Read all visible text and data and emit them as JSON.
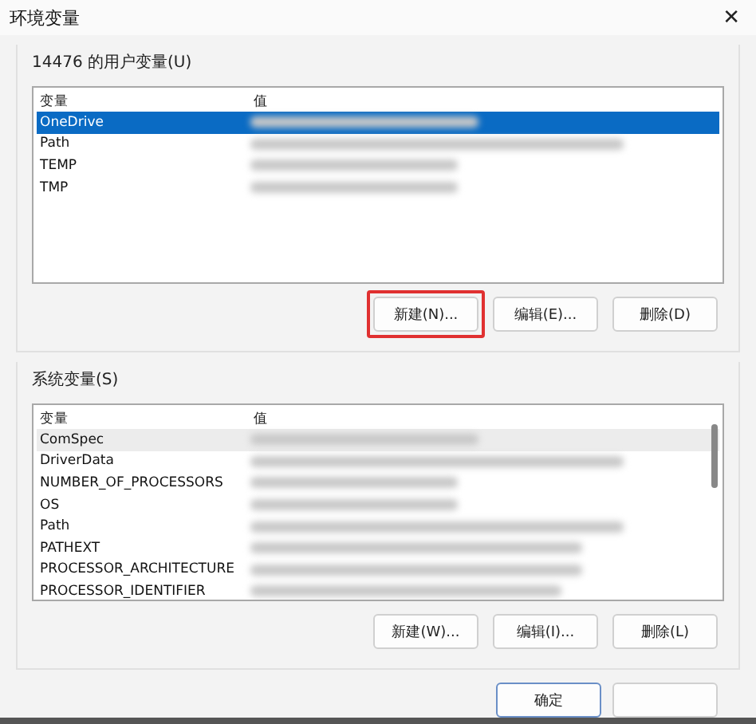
{
  "window": {
    "title": "环境变量",
    "close": "✕"
  },
  "user_vars": {
    "label": "14476 的用户变量(U)",
    "columns": [
      "变量",
      "值"
    ],
    "rows": [
      {
        "name": "OneDrive",
        "selected": true
      },
      {
        "name": "Path",
        "selected": false
      },
      {
        "name": "TEMP",
        "selected": false
      },
      {
        "name": "TMP",
        "selected": false
      }
    ],
    "buttons": [
      {
        "label": "新建(N)...",
        "highlighted": true
      },
      {
        "label": "编辑(E)...",
        "highlighted": false
      },
      {
        "label": "删除(D)",
        "highlighted": false
      }
    ]
  },
  "system_vars": {
    "label": "系统变量(S)",
    "columns": [
      "变量",
      "值"
    ],
    "rows": [
      {
        "name": "ComSpec",
        "selected": true
      },
      {
        "name": "DriverData",
        "selected": false
      },
      {
        "name": "NUMBER_OF_PROCESSORS",
        "selected": false
      },
      {
        "name": "OS",
        "selected": false
      },
      {
        "name": "Path",
        "selected": false
      },
      {
        "name": "PATHEXT",
        "selected": false
      },
      {
        "name": "PROCESSOR_ARCHITECTURE",
        "selected": false
      },
      {
        "name": "PROCESSOR_IDENTIFIER",
        "selected": false
      }
    ],
    "buttons": [
      {
        "label": "新建(W)...",
        "highlighted": false
      },
      {
        "label": "编辑(I)...",
        "highlighted": false
      },
      {
        "label": "删除(L)",
        "highlighted": false
      }
    ]
  },
  "footer_buttons": [
    {
      "label": "确定",
      "default": true
    },
    {
      "default": false
    }
  ]
}
